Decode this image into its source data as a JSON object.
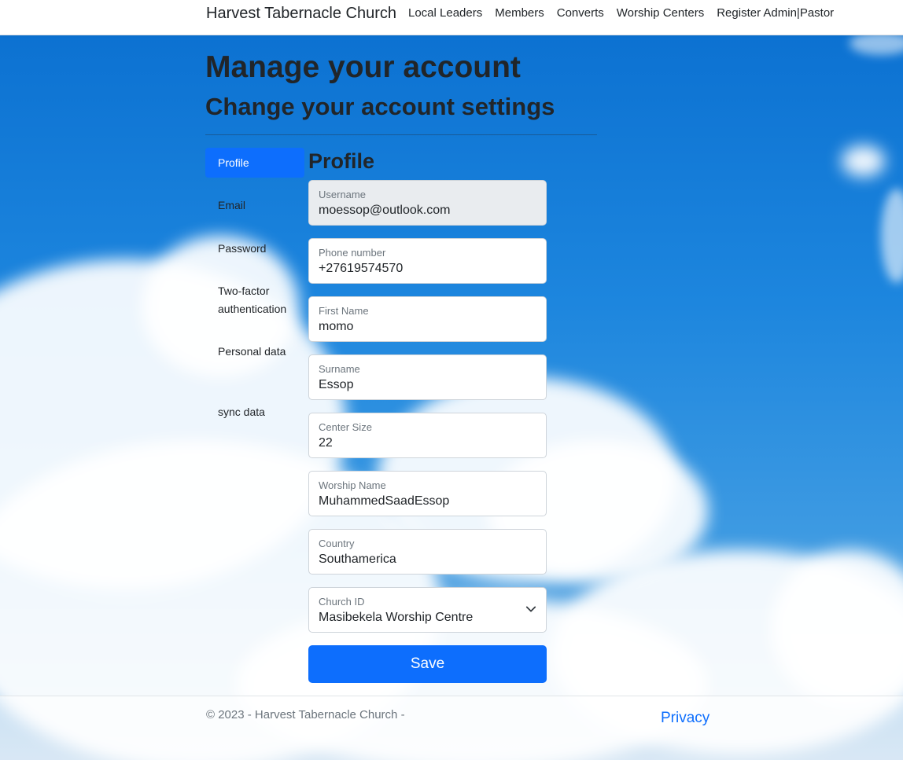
{
  "navbar": {
    "brand": "Harvest Tabernacle Church",
    "links": [
      "Local Leaders",
      "Members",
      "Converts",
      "Worship Centers",
      "Register Admin|Pastor"
    ]
  },
  "page": {
    "title": "Manage your account",
    "subtitle": "Change your account settings"
  },
  "sidebar": {
    "items": [
      {
        "label": "Profile",
        "active": true
      },
      {
        "label": "Email",
        "active": false
      },
      {
        "label": "Password",
        "active": false
      },
      {
        "label": "Two-factor authentication",
        "active": false
      },
      {
        "label": "Personal data",
        "active": false
      },
      {
        "label": "sync data",
        "active": false
      }
    ]
  },
  "form": {
    "title": "Profile",
    "fields": [
      {
        "label": "Username",
        "value": "moessop@outlook.com",
        "disabled": true
      },
      {
        "label": "Phone number",
        "value": "+27619574570"
      },
      {
        "label": "First Name",
        "value": "momo"
      },
      {
        "label": "Surname",
        "value": "Essop"
      },
      {
        "label": "Center Size",
        "value": "22"
      },
      {
        "label": "Worship Name",
        "value": "MuhammedSaadEssop"
      },
      {
        "label": "Country",
        "value": "Southamerica"
      },
      {
        "label": "Church ID",
        "value": "Masibekela Worship Centre",
        "type": "select"
      }
    ],
    "save_label": "Save"
  },
  "footer": {
    "copyright": "© 2023 - Harvest Tabernacle Church -",
    "privacy": "Privacy"
  },
  "colors": {
    "primary": "#0d6efd",
    "sky": "#1f7fd6"
  },
  "icons": {
    "select": "chevron-down-icon"
  }
}
